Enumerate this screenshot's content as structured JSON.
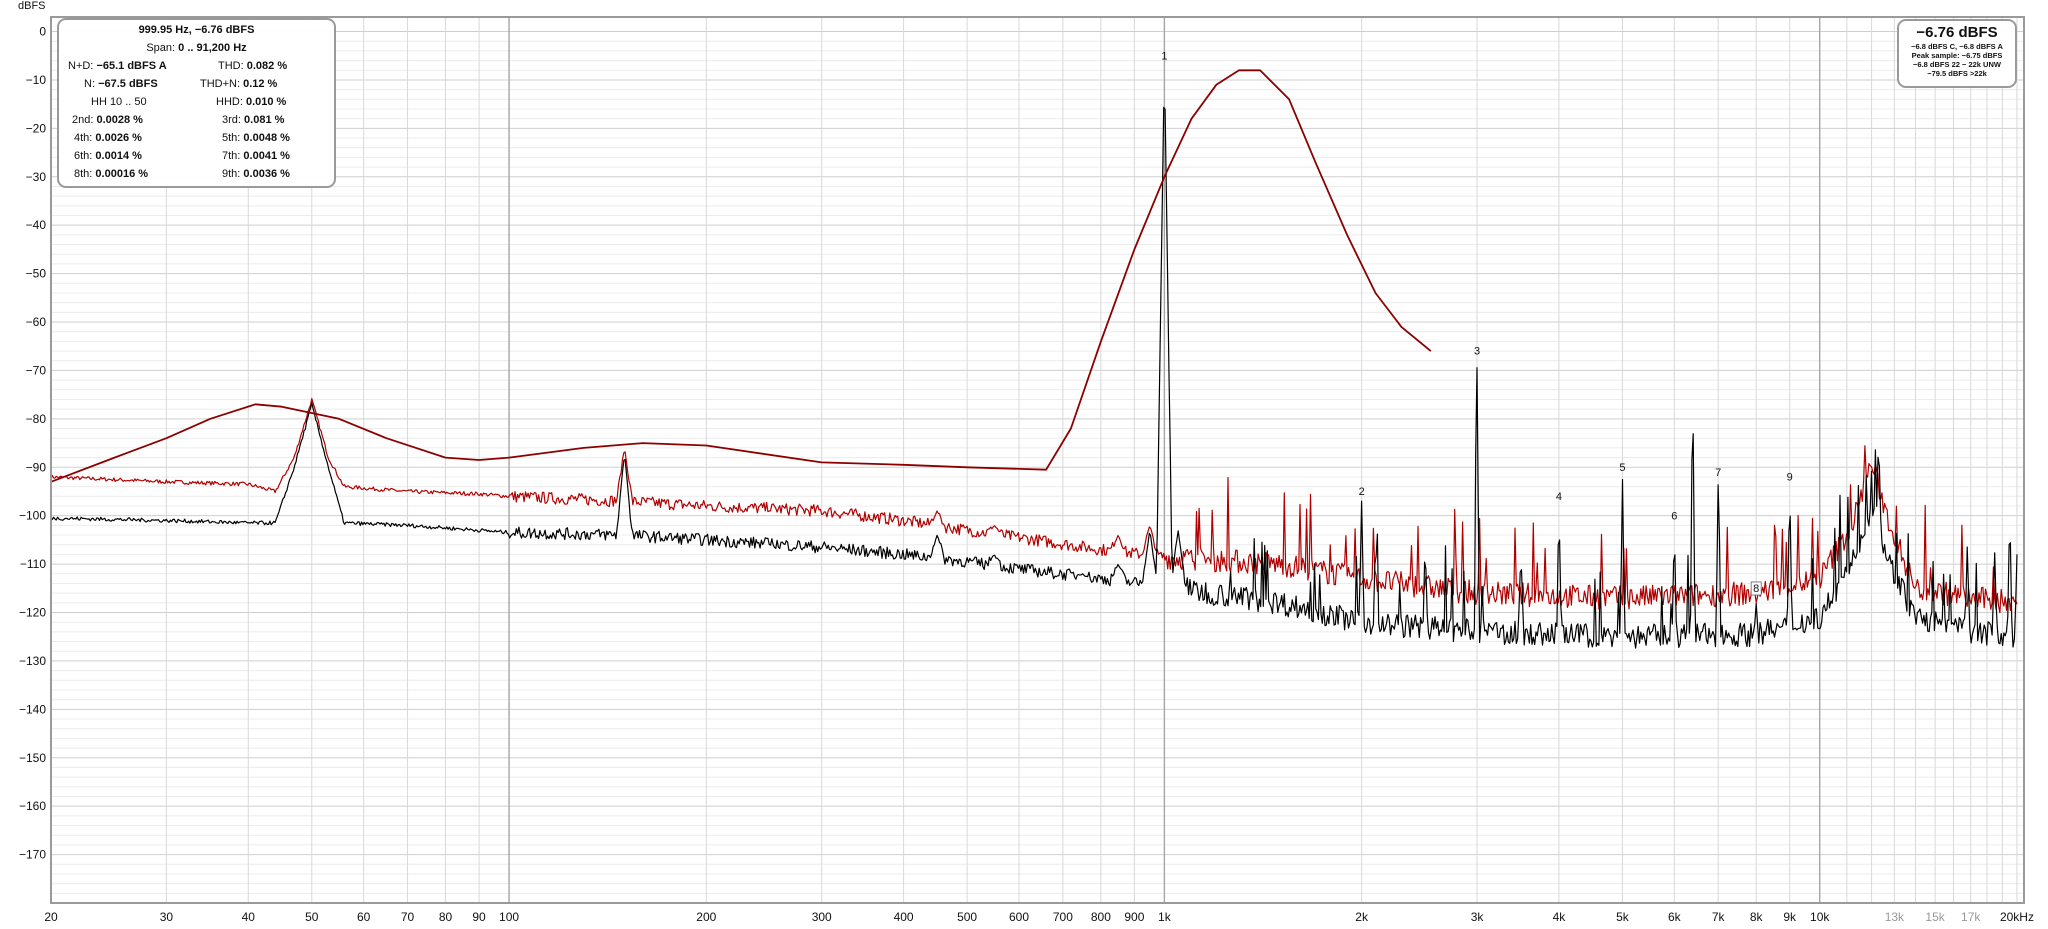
{
  "y_unit": "dBFS",
  "stats_panel": {
    "freq_readout": "999.95 Hz, −6.76 dBFS",
    "span_label": "Span:",
    "span_value": "0 .. 91,200 Hz",
    "nd_label": "N+D:",
    "nd_value": "−65.1 dBFS A",
    "thd_label": "THD:",
    "thd_value": "0.082 %",
    "n_label": "N:",
    "n_value": "−67.5 dBFS",
    "thdn_label": "THD+N:",
    "thdn_value": "0.12 %",
    "hh_label": "HH 10 .. 50",
    "hhd_label": "HHD:",
    "hhd_value": "0.010 %",
    "h2_label": "2nd:",
    "h2_value": "0.0028 %",
    "h3_label": "3rd:",
    "h3_value": "0.081 %",
    "h4_label": "4th:",
    "h4_value": "0.0026 %",
    "h5_label": "5th:",
    "h5_value": "0.0048 %",
    "h6_label": "6th:",
    "h6_value": "0.0014 %",
    "h7_label": "7th:",
    "h7_value": "0.0041 %",
    "h8_label": "8th:",
    "h8_value": "0.00016 %",
    "h9_label": "9th:",
    "h9_value": "0.0036 %"
  },
  "level_panel": {
    "big": "−6.76 dBFS",
    "line1": "−6.8 dBFS C, −6.8 dBFS A",
    "line2": "Peak sample: −6.75 dBFS",
    "line3": "−6.8 dBFS 22 − 22k UNW",
    "line4": "−79.5 dBFS >22k"
  },
  "colors": {
    "black_trace": "#000000",
    "red_trace": "#b00000",
    "envelope": "#8b0000",
    "grid": "#d8d8d8",
    "grid_major": "#a6a6a6"
  },
  "chart_data": {
    "type": "line",
    "xscale": "log",
    "xlim": [
      20,
      20500
    ],
    "ylim": [
      -180,
      3
    ],
    "ylabel": "dBFS",
    "x_ticks": [
      {
        "v": 20,
        "label": "20"
      },
      {
        "v": 30,
        "label": "30"
      },
      {
        "v": 40,
        "label": "40"
      },
      {
        "v": 50,
        "label": "50"
      },
      {
        "v": 60,
        "label": "60"
      },
      {
        "v": 70,
        "label": "70"
      },
      {
        "v": 80,
        "label": "80"
      },
      {
        "v": 90,
        "label": "90"
      },
      {
        "v": 100,
        "label": "100"
      },
      {
        "v": 200,
        "label": "200"
      },
      {
        "v": 300,
        "label": "300"
      },
      {
        "v": 400,
        "label": "400"
      },
      {
        "v": 500,
        "label": "500"
      },
      {
        "v": 600,
        "label": "600"
      },
      {
        "v": 700,
        "label": "700"
      },
      {
        "v": 800,
        "label": "800"
      },
      {
        "v": 900,
        "label": "900"
      },
      {
        "v": 1000,
        "label": "1k"
      },
      {
        "v": 2000,
        "label": "2k"
      },
      {
        "v": 3000,
        "label": "3k"
      },
      {
        "v": 4000,
        "label": "4k"
      },
      {
        "v": 5000,
        "label": "5k"
      },
      {
        "v": 6000,
        "label": "6k"
      },
      {
        "v": 7000,
        "label": "7k"
      },
      {
        "v": 8000,
        "label": "8k"
      },
      {
        "v": 9000,
        "label": "9k"
      },
      {
        "v": 10000,
        "label": "10k"
      },
      {
        "v": 13000,
        "label": "13k",
        "dim": true
      },
      {
        "v": 15000,
        "label": "15k",
        "dim": true
      },
      {
        "v": 17000,
        "label": "17k",
        "dim": true
      },
      {
        "v": 20000,
        "label": "20kHz"
      }
    ],
    "y_ticks": [
      0,
      -10,
      -20,
      -30,
      -40,
      -50,
      -60,
      -70,
      -80,
      -90,
      -100,
      -110,
      -120,
      -130,
      -140,
      -150,
      -160,
      -170
    ],
    "harmonic_markers": [
      {
        "label": "1",
        "freq": 1000,
        "db": -7
      },
      {
        "label": "2",
        "freq": 2000,
        "db": -97
      },
      {
        "label": "3",
        "freq": 3000,
        "db": -68
      },
      {
        "label": "4",
        "freq": 4000,
        "db": -98
      },
      {
        "label": "5",
        "freq": 5000,
        "db": -92
      },
      {
        "label": "6",
        "freq": 6000,
        "db": -102
      },
      {
        "label": "7",
        "freq": 7000,
        "db": -93
      },
      {
        "label": "8",
        "freq": 8000,
        "db": -117,
        "boxed": true
      },
      {
        "label": "9",
        "freq": 9000,
        "db": -94
      }
    ],
    "series": [
      {
        "color": "#000000",
        "values": [
          [
            20,
            -100.5
          ],
          [
            30,
            -101
          ],
          [
            40,
            -101.5
          ],
          [
            44,
            -101.5
          ],
          [
            47,
            -90
          ],
          [
            50,
            -77
          ],
          [
            53,
            -90
          ],
          [
            56,
            -101.5
          ],
          [
            70,
            -102
          ],
          [
            90,
            -103
          ],
          [
            100,
            -103.5
          ],
          [
            150,
            -104
          ],
          [
            200,
            -105
          ],
          [
            300,
            -106.5
          ],
          [
            400,
            -108
          ],
          [
            500,
            -109.5
          ],
          [
            600,
            -111
          ],
          [
            800,
            -113
          ],
          [
            1000,
            -114.5
          ],
          [
            1500,
            -118
          ],
          [
            2000,
            -122
          ],
          [
            3000,
            -124
          ],
          [
            5000,
            -125
          ],
          [
            8000,
            -124.5
          ],
          [
            10000,
            -121
          ],
          [
            11200,
            -110
          ],
          [
            12000,
            -98
          ],
          [
            12800,
            -110
          ],
          [
            14000,
            -121
          ],
          [
            17000,
            -124
          ],
          [
            20000,
            -125
          ]
        ],
        "spikes": [
          [
            1000,
            -7
          ],
          [
            950,
            -103
          ],
          [
            1050,
            -103
          ],
          [
            150,
            -87
          ],
          [
            250,
            -106
          ],
          [
            350,
            -110
          ],
          [
            450,
            -104
          ],
          [
            550,
            -108
          ],
          [
            750,
            -112
          ],
          [
            850,
            -110
          ],
          [
            2000,
            -97
          ],
          [
            2100,
            -104
          ],
          [
            2500,
            -105
          ],
          [
            3000,
            -68
          ],
          [
            3500,
            -106
          ],
          [
            4000,
            -98
          ],
          [
            5000,
            -92
          ],
          [
            6000,
            -102
          ],
          [
            6400,
            -70
          ],
          [
            7000,
            -93
          ],
          [
            8000,
            -118
          ],
          [
            9000,
            -94
          ],
          [
            12300,
            -83
          ],
          [
            16800,
            -105
          ],
          [
            18500,
            -107
          ],
          [
            19500,
            -98
          ],
          [
            20000,
            -108
          ]
        ]
      },
      {
        "color": "#b00000",
        "values": [
          [
            20,
            -92
          ],
          [
            30,
            -93
          ],
          [
            40,
            -93.5
          ],
          [
            44,
            -95
          ],
          [
            47,
            -88
          ],
          [
            50,
            -76
          ],
          [
            53,
            -88
          ],
          [
            56,
            -94
          ],
          [
            70,
            -95
          ],
          [
            90,
            -95.5
          ],
          [
            100,
            -96
          ],
          [
            150,
            -97
          ],
          [
            200,
            -98
          ],
          [
            300,
            -99
          ],
          [
            400,
            -101
          ],
          [
            500,
            -103
          ],
          [
            600,
            -104.5
          ],
          [
            800,
            -107
          ],
          [
            1000,
            -108.5
          ],
          [
            1500,
            -110
          ],
          [
            2000,
            -113
          ],
          [
            3000,
            -116
          ],
          [
            5000,
            -117
          ],
          [
            8000,
            -116
          ],
          [
            10000,
            -113
          ],
          [
            11200,
            -102
          ],
          [
            12000,
            -89
          ],
          [
            12800,
            -102
          ],
          [
            14000,
            -115
          ],
          [
            17000,
            -117
          ],
          [
            20000,
            -118
          ]
        ],
        "spikes": [
          [
            150,
            -86
          ],
          [
            250,
            -99
          ],
          [
            450,
            -99
          ],
          [
            550,
            -102
          ],
          [
            850,
            -104
          ],
          [
            950,
            -102
          ]
        ]
      },
      {
        "color": "#8b0000",
        "smooth": true,
        "values": [
          [
            20,
            -93
          ],
          [
            25,
            -88
          ],
          [
            30,
            -84
          ],
          [
            35,
            -80
          ],
          [
            41,
            -77
          ],
          [
            45,
            -77.5
          ],
          [
            55,
            -80
          ],
          [
            65,
            -84
          ],
          [
            80,
            -88
          ],
          [
            90,
            -88.5
          ],
          [
            100,
            -88
          ],
          [
            130,
            -86
          ],
          [
            160,
            -85
          ],
          [
            200,
            -85.5
          ],
          [
            300,
            -89
          ],
          [
            400,
            -89.5
          ],
          [
            500,
            -90
          ],
          [
            660,
            -90.5
          ],
          [
            720,
            -82
          ],
          [
            800,
            -64
          ],
          [
            900,
            -45
          ],
          [
            1000,
            -30
          ],
          [
            1100,
            -18
          ],
          [
            1200,
            -11
          ],
          [
            1300,
            -8
          ],
          [
            1400,
            -8
          ],
          [
            1550,
            -14
          ],
          [
            1700,
            -27
          ],
          [
            1900,
            -42
          ],
          [
            2100,
            -54
          ],
          [
            2300,
            -61
          ],
          [
            2550,
            -66
          ]
        ]
      }
    ]
  }
}
